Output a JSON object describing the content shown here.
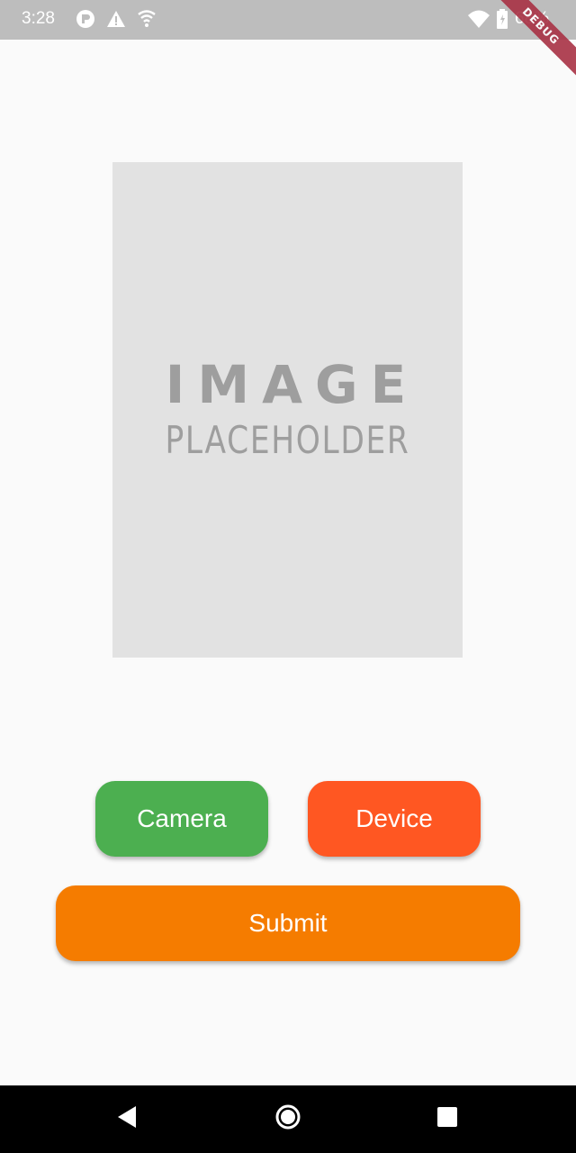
{
  "status_bar": {
    "time": "3:28",
    "battery_percent": "68%",
    "icons": [
      "notification-app-icon",
      "warning-icon",
      "vpn-shield-icon",
      "wifi-icon",
      "battery-icon"
    ]
  },
  "debug_banner": {
    "label": "DEBUG"
  },
  "image_placeholder": {
    "title": "IMAGE",
    "subtitle": "PLACEHOLDER"
  },
  "buttons": {
    "camera_label": "Camera",
    "device_label": "Device",
    "submit_label": "Submit"
  },
  "colors": {
    "camera": "#4caf50",
    "device": "#ff5722",
    "submit": "#f57c00",
    "status_bar": "#bdbdbd",
    "background": "#fafafa"
  },
  "nav_bar": {
    "icons": [
      "back-icon",
      "home-icon",
      "recents-icon"
    ]
  }
}
